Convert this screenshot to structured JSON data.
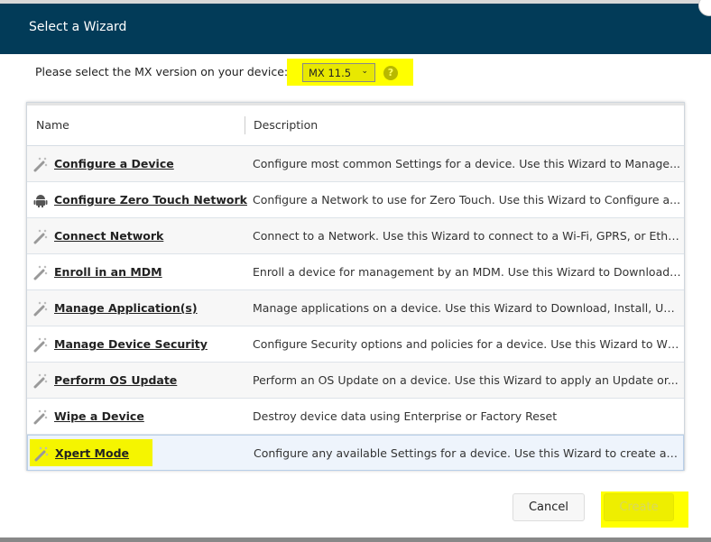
{
  "dialog": {
    "title": "Select a Wizard"
  },
  "mx": {
    "label": "Please select the MX version on your device:",
    "selected": "MX 11.5",
    "help": "?"
  },
  "table": {
    "headers": [
      "Name",
      "Description"
    ],
    "rows": [
      {
        "name": "Configure a Device",
        "description": "Configure most common Settings for a device. Use this Wizard to Manage...",
        "icon": "wand-icon"
      },
      {
        "name": "Configure Zero Touch Network",
        "description": "Configure a Network to use for Zero Touch. Use this Wizard to Configure a...",
        "icon": "android-icon"
      },
      {
        "name": "Connect Network",
        "description": "Connect to a Network. Use this Wizard to connect to a Wi-Fi, GPRS, or Ethe...",
        "icon": "wand-icon"
      },
      {
        "name": "Enroll in an MDM",
        "description": "Enroll a device for management by an MDM.  Use this Wizard to Download,...",
        "icon": "wand-icon"
      },
      {
        "name": "Manage Application(s)",
        "description": "Manage applications on a device.  Use this Wizard to Download, Install, Uni...",
        "icon": "wand-icon"
      },
      {
        "name": "Manage Device Security",
        "description": "Configure Security options and policies for a device.  Use this Wizard to Wh...",
        "icon": "wand-icon"
      },
      {
        "name": "Perform OS Update",
        "description": "Perform an OS Update on a device.  Use this Wizard to apply an Update or...",
        "icon": "wand-icon"
      },
      {
        "name": "Wipe a Device",
        "description": "Destroy device data using Enterprise or Factory Reset",
        "icon": "wand-icon"
      },
      {
        "name": "Xpert Mode",
        "description": "Configure any available Settings for a device. Use this Wizard to create any...",
        "icon": "wand-icon",
        "selected": true
      }
    ]
  },
  "footer": {
    "cancel": "Cancel",
    "create": "Create"
  },
  "colors": {
    "header": "#023b58",
    "highlight": "#ffff00"
  }
}
